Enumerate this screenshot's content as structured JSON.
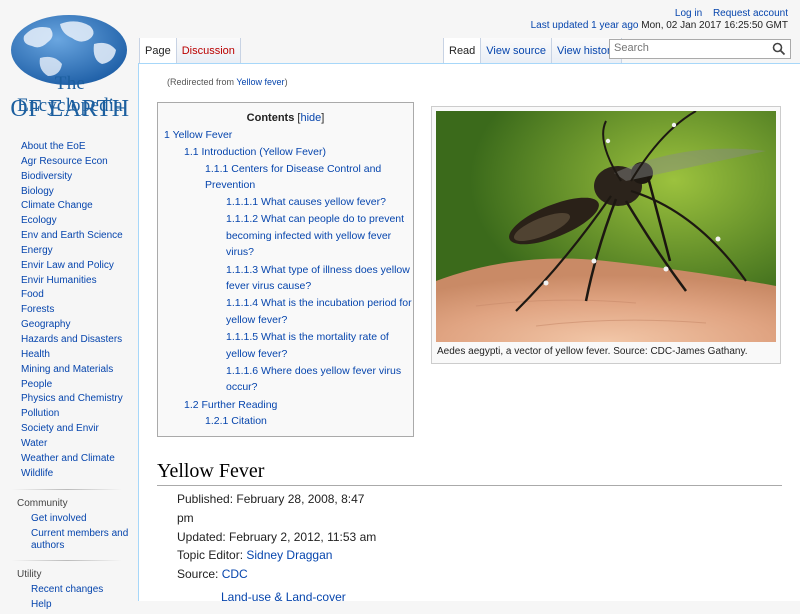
{
  "personal": {
    "login": "Log in",
    "request_account": "Request account",
    "last_updated_link": "Last updated 1 year ago",
    "last_updated_date": "Mon, 02 Jan 2017 16:25:50 GMT"
  },
  "logo": {
    "line1": "The Encyclopedia",
    "line2": "OF EARTH"
  },
  "sidebar": {
    "topics": [
      "About the EoE",
      "Agr Resource Econ",
      "Biodiversity",
      "Biology",
      "Climate Change",
      "Ecology",
      "Env and Earth Science",
      "Energy",
      "Envir Law and Policy",
      "Envir Humanities",
      "Food",
      "Forests",
      "Geography",
      "Hazards and Disasters",
      "Health",
      "Mining and Materials",
      "People",
      "Physics and Chemistry",
      "Pollution",
      "Society and Envir",
      "Water",
      "Weather and Climate",
      "Wildlife"
    ],
    "community_heading": "Community",
    "community": [
      "Get involved",
      "Current members and authors"
    ],
    "utility_heading": "Utility",
    "utility": [
      "Recent changes",
      "Help"
    ]
  },
  "tabs": {
    "page": "Page",
    "discussion": "Discussion",
    "read": "Read",
    "view_source": "View source",
    "view_history": "View history"
  },
  "search": {
    "placeholder": "Search"
  },
  "redirect": {
    "prefix": "(Redirected from ",
    "link": "Yellow fever",
    "suffix": ")"
  },
  "toc": {
    "title": "Contents",
    "hide": "hide",
    "entries": [
      "1 Yellow Fever",
      "1.1 Introduction (Yellow Fever)",
      "1.1.1 Centers for Disease Control and",
      "Prevention",
      "1.1.1.1 What causes yellow fever?",
      "1.1.1.2 What can people do to prevent",
      "becoming infected with yellow fever",
      "virus?",
      "1.1.1.3 What type of illness does yellow",
      "fever virus cause?",
      "1.1.1.4 What is the incubation period for",
      "yellow fever?",
      "1.1.1.5 What is the mortality rate of",
      "yellow fever?",
      "1.1.1.6 Where does yellow fever virus",
      "occur?",
      "1.2 Further Reading",
      "1.2.1 Citation"
    ]
  },
  "thumb": {
    "caption": "Aedes aegypti, a vector of yellow fever. Source: CDC-James Gathany."
  },
  "article": {
    "title": "Yellow Fever",
    "published_line1": "Published: February 28, 2008, 8:47",
    "published_line2": "pm",
    "updated": "Updated: February 2, 2012, 11:53 am",
    "topic_editor_label": "Topic Editor: ",
    "topic_editor": "Sidney Draggan",
    "source_label": "Source: ",
    "source": "CDC",
    "category": "Land-use & Land-cover"
  }
}
